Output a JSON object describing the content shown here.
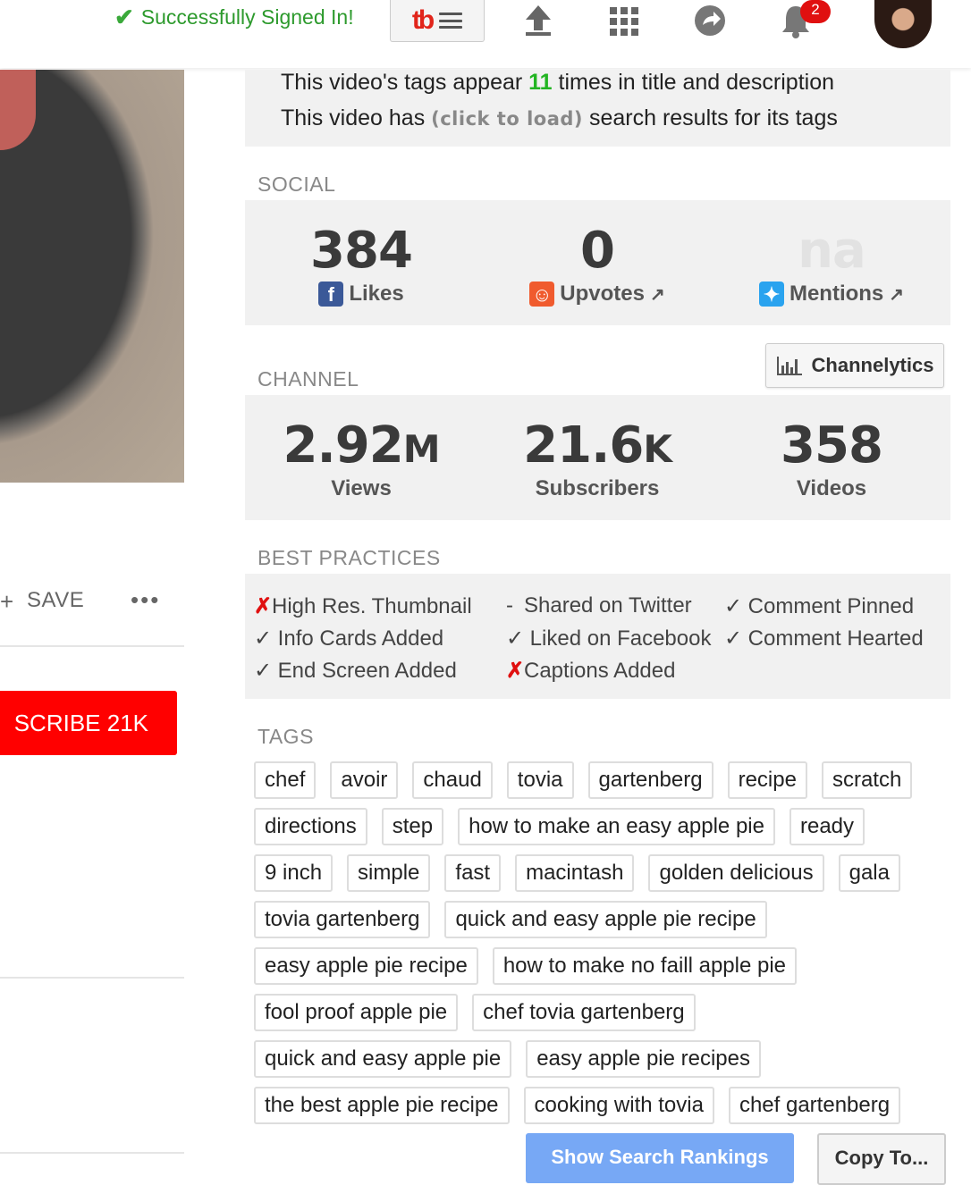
{
  "topbar": {
    "signed_in_message": "Successfully Signed In!",
    "logo_text": "tb",
    "notification_count": "2"
  },
  "youtube": {
    "save_label": "SAVE",
    "more_label": "•••",
    "subscribe_label": "SCRIBE 21K"
  },
  "summary": {
    "tags_line_prefix": "This video's tags appear ",
    "tags_count": "11",
    "tags_line_suffix": " times in title and description",
    "search_line_prefix": "This video has ",
    "click_to_load": "(click to load)",
    "search_line_suffix": " search results for its tags"
  },
  "social": {
    "title": "SOCIAL",
    "stats": [
      {
        "value": "384",
        "label": "Likes",
        "icon": "facebook-icon",
        "color": "#3b5998"
      },
      {
        "value": "0",
        "label": "Upvotes",
        "icon": "reddit-icon",
        "color": "#f05b2e"
      },
      {
        "value": "na",
        "label": "Mentions",
        "icon": "twitter-icon",
        "color": "#2aa3ef"
      }
    ]
  },
  "channel": {
    "title": "CHANNEL",
    "button_label": "Channelytics",
    "stats": [
      {
        "value": "2.92",
        "suffix": "M",
        "label": "Views"
      },
      {
        "value": "21.6",
        "suffix": "K",
        "label": "Subscribers"
      },
      {
        "value": "358",
        "suffix": "",
        "label": "Videos"
      }
    ]
  },
  "best_practices": {
    "title": "BEST PRACTICES",
    "items": [
      {
        "mark": "✗",
        "status": "fail",
        "label": "High Res. Thumbnail"
      },
      {
        "mark": "✓",
        "status": "pass",
        "label": "Info Cards Added"
      },
      {
        "mark": "✓",
        "status": "pass",
        "label": "End Screen Added"
      },
      {
        "mark": "-",
        "status": "neutral",
        "label": "Shared on Twitter"
      },
      {
        "mark": "✓",
        "status": "pass",
        "label": "Liked on Facebook"
      },
      {
        "mark": "✗",
        "status": "fail",
        "label": "Captions Added"
      },
      {
        "mark": "✓",
        "status": "pass",
        "label": "Comment Pinned"
      },
      {
        "mark": "✓",
        "status": "pass",
        "label": "Comment Hearted"
      }
    ]
  },
  "tags": {
    "title": "TAGS",
    "rows": [
      [
        "chef",
        "avoir",
        "chaud",
        "tovia",
        "gartenberg",
        "recipe",
        "scratch"
      ],
      [
        "directions",
        "step",
        "how to make an easy apple pie",
        "ready"
      ],
      [
        "9 inch",
        "simple",
        "fast",
        "macintash",
        "golden delicious",
        "gala"
      ],
      [
        "tovia gartenberg",
        "quick and easy apple pie recipe"
      ],
      [
        "easy apple pie recipe",
        "how to make no faill apple pie"
      ],
      [
        "fool proof apple pie",
        "chef tovia gartenberg"
      ],
      [
        "quick and easy apple pie",
        "easy apple pie recipes"
      ],
      [
        "the best apple pie recipe",
        "cooking with tovia",
        "chef gartenberg"
      ]
    ]
  },
  "actions": {
    "show_rankings": "Show Search Rankings",
    "copy_to": "Copy To..."
  }
}
